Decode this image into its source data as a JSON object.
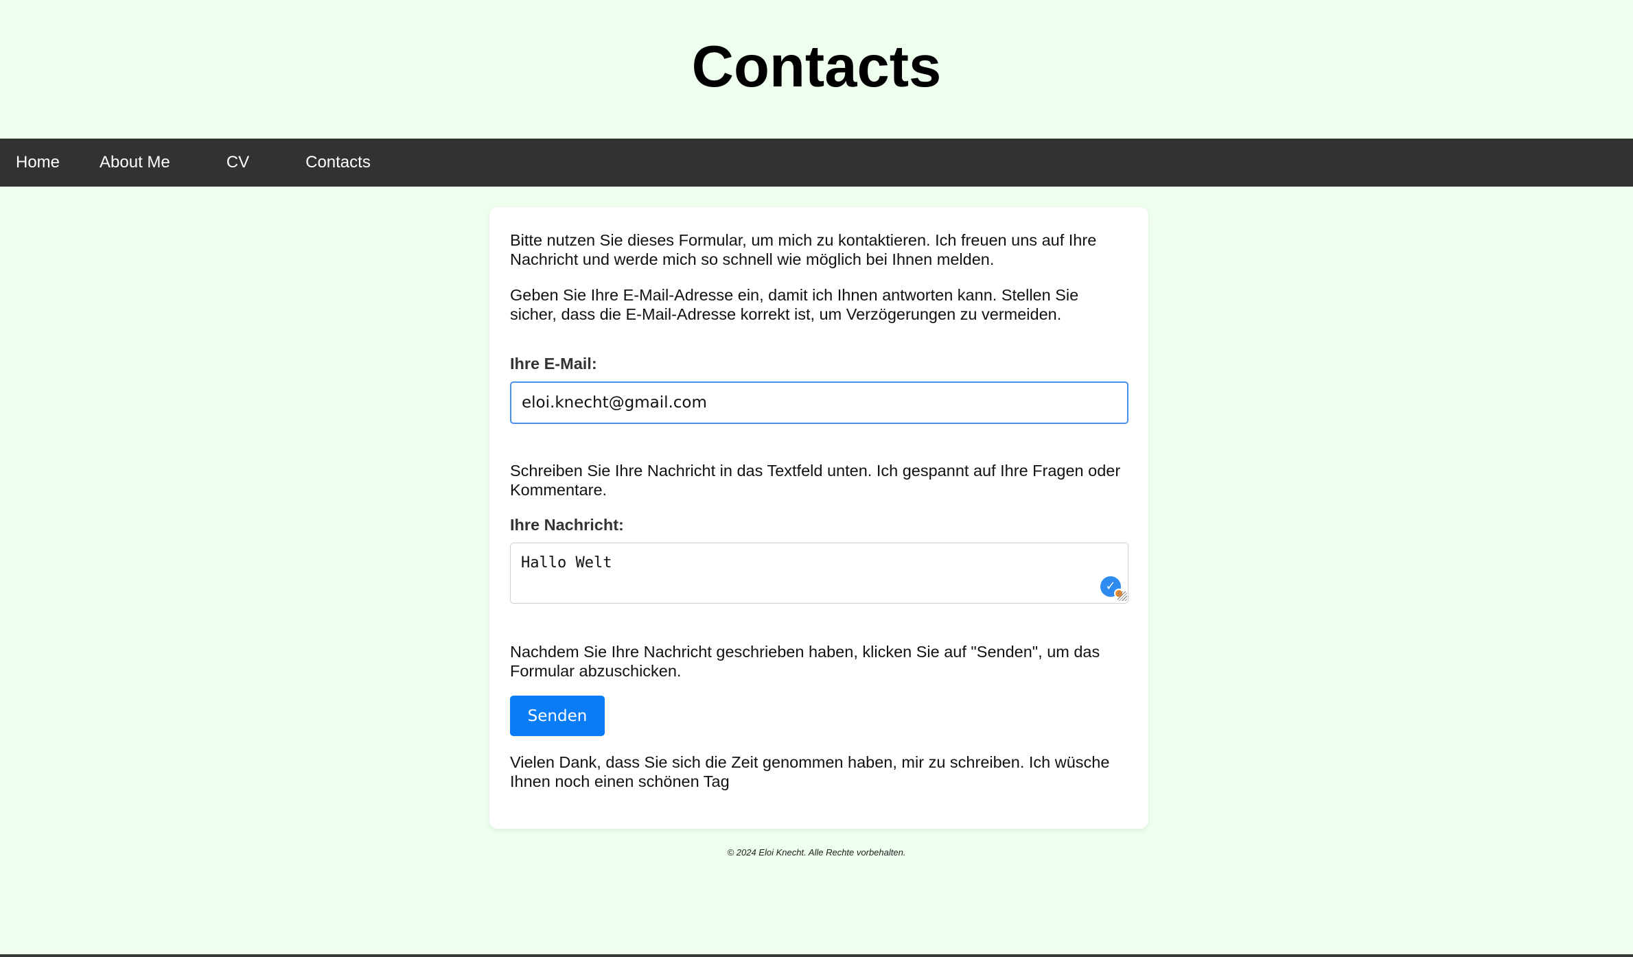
{
  "header": {
    "title": "Contacts"
  },
  "nav": {
    "items": [
      {
        "label": "Home"
      },
      {
        "label": "About Me"
      },
      {
        "label": "CV"
      },
      {
        "label": "Contacts"
      }
    ]
  },
  "form": {
    "intro": "Bitte nutzen Sie dieses Formular, um mich zu kontaktieren. Ich freuen uns auf Ihre Nachricht und werde mich so schnell wie möglich bei Ihnen melden.",
    "email_hint": "Geben Sie Ihre E-Mail-Adresse ein, damit ich Ihnen antworten kann. Stellen Sie sicher, dass die E-Mail-Adresse korrekt ist, um Verzögerungen zu vermeiden.",
    "email_label": "Ihre E-Mail:",
    "email_value": "eloi.knecht@gmail.com",
    "message_hint": "Schreiben Sie Ihre Nachricht in das Textfeld unten. Ich gespannt auf Ihre Fragen oder Kommentare.",
    "message_label": "Ihre Nachricht:",
    "message_value": "Hallo Welt",
    "send_hint": "Nachdem Sie Ihre Nachricht geschrieben haben, klicken Sie auf \"Senden\", um das Formular abzuschicken.",
    "send_label": "Senden",
    "thanks": "Vielen Dank, dass Sie sich die Zeit genommen haben, mir zu schreiben. Ich wüsche Ihnen noch einen schönen Tag"
  },
  "footer": {
    "text": "© 2024 Eloi Knecht. Alle Rechte vorbehalten."
  },
  "colors": {
    "page_background": "#eeffee",
    "navbar": "#30332f",
    "button": "#0a7cf6",
    "input_focus_border": "#4a8fe8"
  },
  "icons": {
    "grammar_check": "checkmark-badge-icon",
    "resize": "resize-handle-icon"
  }
}
